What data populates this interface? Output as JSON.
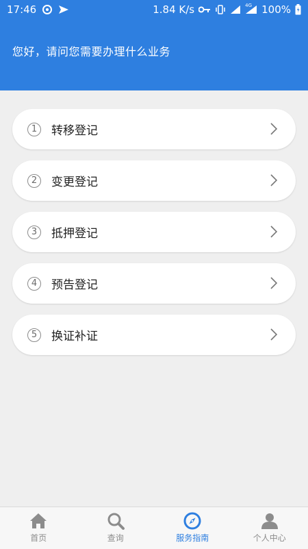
{
  "status_bar": {
    "time": "17:46",
    "network_speed": "1.84 K/s",
    "battery": "100%",
    "signal_label": "4G",
    "icons": [
      "weibo-icon",
      "send-icon",
      "key-icon",
      "vibrate-icon",
      "signal-icon",
      "battery-icon"
    ]
  },
  "header": {
    "greeting": "您好，请问您需要办理什么业务"
  },
  "services": [
    {
      "num": "1",
      "label": "转移登记"
    },
    {
      "num": "2",
      "label": "变更登记"
    },
    {
      "num": "3",
      "label": "抵押登记"
    },
    {
      "num": "4",
      "label": "预告登记"
    },
    {
      "num": "5",
      "label": "换证补证"
    }
  ],
  "tabbar": {
    "tabs": [
      {
        "label": "首页",
        "icon": "home-icon"
      },
      {
        "label": "查询",
        "icon": "search-icon"
      },
      {
        "label": "服务指南",
        "icon": "compass-icon",
        "active": true
      },
      {
        "label": "个人中心",
        "icon": "person-icon"
      }
    ]
  },
  "colors": {
    "primary": "#2e7fe0",
    "background": "#efefef",
    "inactive_tab": "#8c8c8c"
  }
}
